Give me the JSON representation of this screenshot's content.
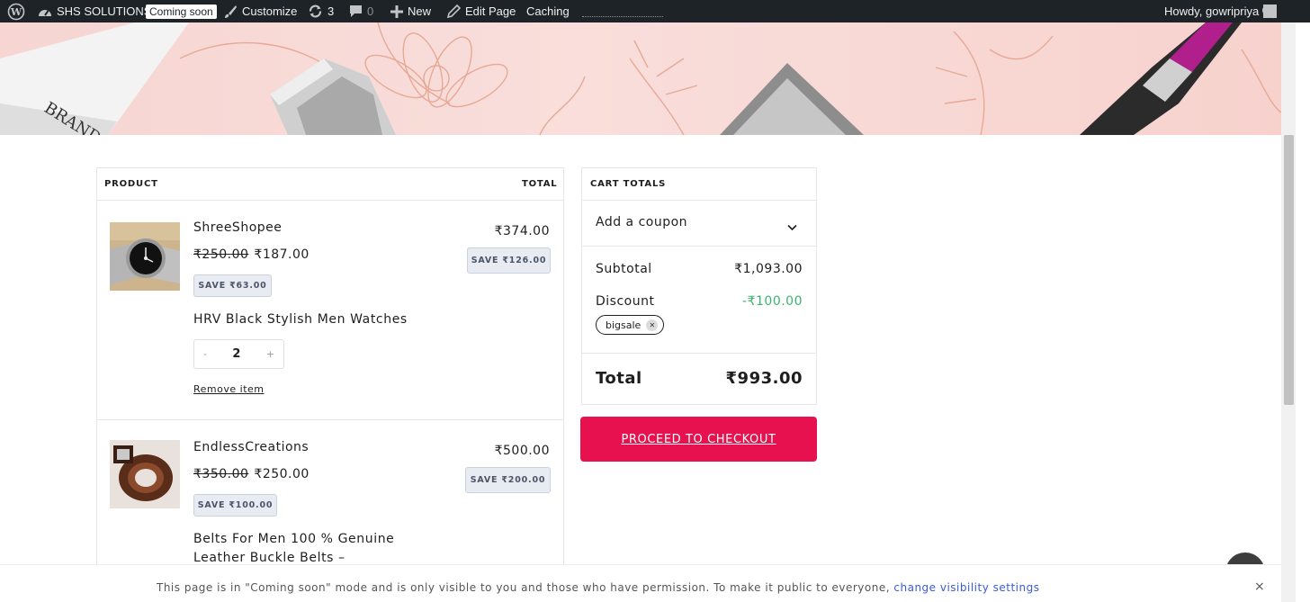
{
  "admin_bar": {
    "site_name": "SHS SOLUTIONS",
    "coming_soon_badge": "Coming soon",
    "customize": "Customize",
    "updates_count": "3",
    "comments_count": "0",
    "new": "New",
    "edit_page": "Edit Page",
    "caching": "Caching",
    "greeting": "Howdy, gowripriya"
  },
  "cart": {
    "headers": {
      "product": "PRODUCT",
      "total": "TOTAL"
    },
    "items": [
      {
        "store": "ShreeShopee",
        "regular_price": "₹250.00",
        "sale_price": "₹187.00",
        "unit_save": "SAVE ₹63.00",
        "title": "HRV Black Stylish Men Watches",
        "quantity": "2",
        "qty_minus": "-",
        "qty_plus": "+",
        "remove": "Remove item",
        "line_total": "₹374.00",
        "line_save": "SAVE ₹126.00"
      },
      {
        "store": "EndlessCreations",
        "regular_price": "₹350.00",
        "sale_price": "₹250.00",
        "unit_save": "SAVE ₹100.00",
        "title_line1": "Belts For Men 100 % Genuine",
        "title_line2": "Leather Buckle Belts –",
        "line_total": "₹500.00",
        "line_save": "SAVE ₹200.00"
      }
    ]
  },
  "totals": {
    "heading": "CART TOTALS",
    "coupon_label": "Add a coupon",
    "subtotal_label": "Subtotal",
    "subtotal_value": "₹1,093.00",
    "discount_label": "Discount",
    "discount_value": "-₹100.00",
    "coupon_code": "bigsale",
    "total_label": "Total",
    "total_value": "₹993.00",
    "discount_color": "#3cb371"
  },
  "checkout": {
    "label": "PROCEED TO CHECKOUT",
    "color": "#e8114f"
  },
  "notice": {
    "text": "This page is in \"Coming soon\" mode and is only visible to you and those who have permission. To make it public to everyone,",
    "link": "change visibility settings",
    "close": "×"
  },
  "icons": {
    "wordpress": "wordpress-logo-icon",
    "site": "dashboard-icon",
    "customize": "brush-icon",
    "updates": "refresh-icon",
    "comments": "comment-icon",
    "new": "plus-icon",
    "edit": "pencil-icon",
    "search": "search-icon",
    "coupon_toggle": "chevron-down-icon",
    "chip_remove": "close-icon"
  }
}
